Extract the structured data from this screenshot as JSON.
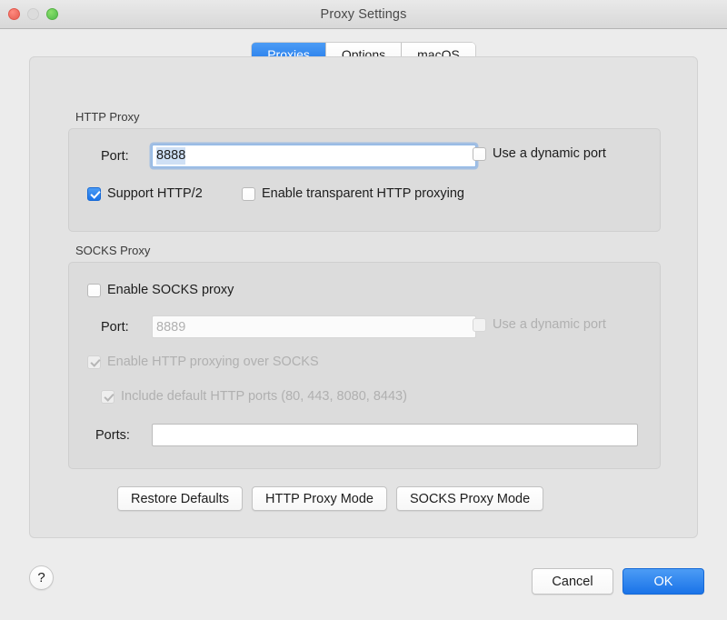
{
  "window": {
    "title": "Proxy Settings",
    "traffic_lights": [
      {
        "name": "close",
        "color": "#ec6a5e"
      },
      {
        "name": "minimize",
        "color": "#dcdcdc"
      },
      {
        "name": "zoom",
        "color": "#61c555"
      }
    ]
  },
  "tabs": [
    {
      "label": "Proxies",
      "active": true
    },
    {
      "label": "Options",
      "active": false
    },
    {
      "label": "macOS",
      "active": false
    }
  ],
  "http_proxy": {
    "group_label": "HTTP Proxy",
    "port_label": "Port:",
    "port_value": "8888",
    "port_focused": true,
    "port_selected": true,
    "dynamic_port_label": "Use a dynamic port",
    "dynamic_port_checked": false,
    "support_http2_label": "Support HTTP/2",
    "support_http2_checked": true,
    "transparent_label": "Enable transparent HTTP proxying",
    "transparent_checked": false
  },
  "socks_proxy": {
    "group_label": "SOCKS Proxy",
    "enable_label": "Enable SOCKS proxy",
    "enable_checked": false,
    "port_label": "Port:",
    "port_value": "8889",
    "port_disabled": true,
    "dynamic_port_label": "Use a dynamic port",
    "dynamic_port_checked": false,
    "dynamic_port_disabled": true,
    "http_over_socks_label": "Enable HTTP proxying over SOCKS",
    "http_over_socks_checked": true,
    "http_over_socks_disabled": true,
    "include_default_ports_label": "Include default HTTP ports (80, 443, 8080, 8443)",
    "include_default_ports_checked": true,
    "include_default_ports_disabled": true,
    "ports_label": "Ports:",
    "ports_value": ""
  },
  "mode_buttons": [
    {
      "label": "Restore Defaults"
    },
    {
      "label": "HTTP Proxy Mode"
    },
    {
      "label": "SOCKS Proxy Mode"
    }
  ],
  "footer": {
    "help_label": "?",
    "cancel_label": "Cancel",
    "ok_label": "OK"
  },
  "colors": {
    "accent": "#1a73e8",
    "window_bg": "#ececec",
    "panel_bg": "#e3e3e3",
    "group_bg": "#dcdcdc",
    "disabled_text": "#b0b0b0",
    "selection": "#cfe0f5"
  }
}
